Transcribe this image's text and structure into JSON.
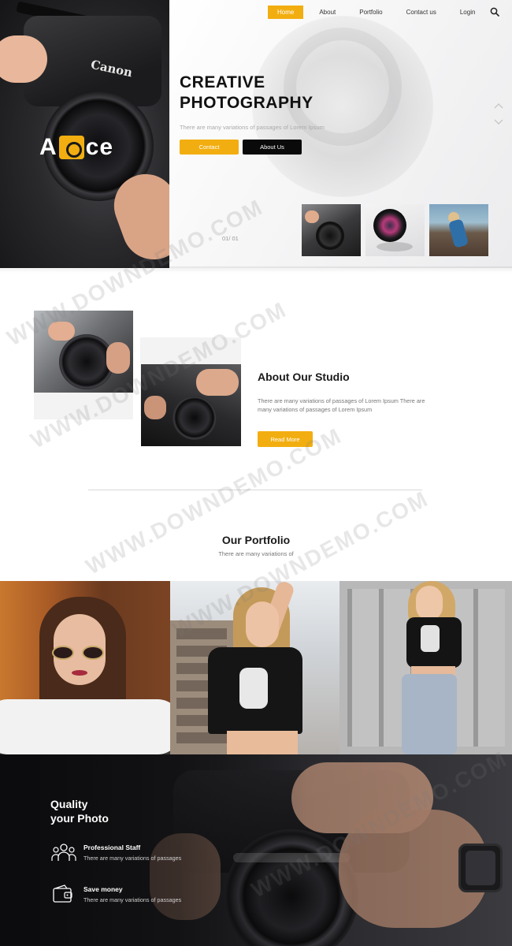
{
  "nav": {
    "items": [
      {
        "label": "Home",
        "active": true
      },
      {
        "label": "About",
        "active": false
      },
      {
        "label": "Portfolio",
        "active": false
      },
      {
        "label": "Contact us",
        "active": false
      },
      {
        "label": "Login",
        "active": false
      }
    ],
    "search_icon": "search-icon"
  },
  "hero": {
    "logo_left": "A",
    "logo_right": "ce",
    "camera_brand": "Canon",
    "title_line1": "CREATIVE",
    "title_line2": "PHOTOGRAPHY",
    "subtitle": "There are many variations of passages of Lorem Ipsum",
    "contact_label": "Contact",
    "about_label": "About Us",
    "pager": "01/ 01",
    "thumbnails": [
      "thumb-camera-hands",
      "thumb-lens",
      "thumb-person-pier"
    ]
  },
  "about": {
    "title": "About Our Studio",
    "text": "There are many variations of passages of Lorem Ipsum There are many variations of passages of Lorem Ipsum",
    "button": "Read More"
  },
  "portfolio": {
    "title": "Our Portfolio",
    "subtitle": "There are many variations of"
  },
  "quality": {
    "title_line1": "Quality",
    "title_line2": "your Photo",
    "features": [
      {
        "title": "Professional Staff",
        "text": "There are many variations of passages",
        "icon": "team-icon"
      },
      {
        "title": "Save money",
        "text": "There are many variations of passages",
        "icon": "wallet-icon"
      }
    ]
  },
  "watermark": "WWW.DOWNDEMO.COM",
  "colors": {
    "accent": "#f2ae10",
    "dark": "#0a0a0a",
    "text": "#1a1a1a"
  }
}
